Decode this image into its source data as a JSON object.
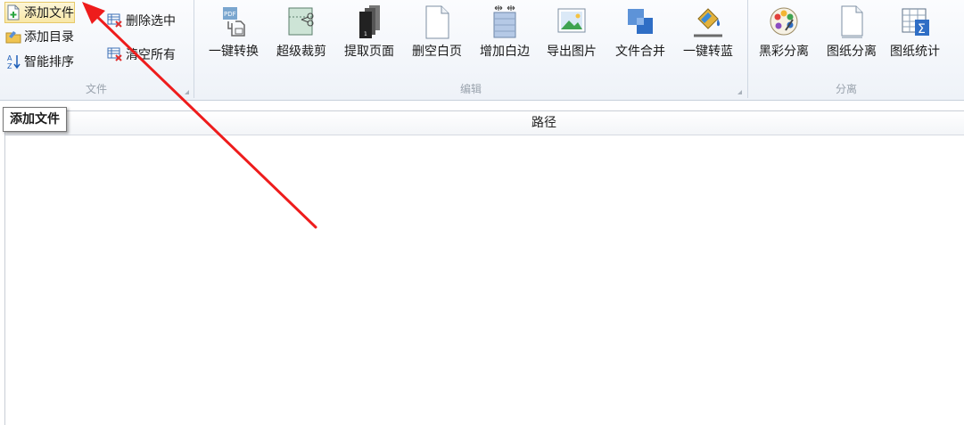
{
  "ribbon": {
    "file_group": {
      "label": "文件",
      "items": [
        {
          "label": "添加文件",
          "icon": "add-file-icon"
        },
        {
          "label": "添加目录",
          "icon": "add-folder-icon"
        },
        {
          "label": "智能排序",
          "icon": "sort-az-icon"
        },
        {
          "label": "删除选中",
          "icon": "delete-selected-icon"
        },
        {
          "label": "清空所有",
          "icon": "clear-all-icon"
        }
      ]
    },
    "edit_group": {
      "label": "编辑",
      "buttons": [
        {
          "label": "一键转换",
          "icon": "pdf-convert-icon"
        },
        {
          "label": "超级裁剪",
          "icon": "crop-scissors-icon"
        },
        {
          "label": "提取页面",
          "icon": "extract-pages-icon"
        },
        {
          "label": "删空白页",
          "icon": "blank-page-icon"
        },
        {
          "label": "增加白边",
          "icon": "add-margin-icon"
        },
        {
          "label": "导出图片",
          "icon": "export-image-icon"
        },
        {
          "label": "文件合并",
          "icon": "merge-files-icon"
        },
        {
          "label": "一键转蓝",
          "icon": "paint-bucket-icon"
        }
      ]
    },
    "separate_group": {
      "label": "分离",
      "buttons": [
        {
          "label": "黑彩分离",
          "icon": "color-palette-icon"
        },
        {
          "label": "图纸分离",
          "icon": "drawing-page-icon"
        },
        {
          "label": "图纸统计",
          "icon": "sum-table-icon"
        }
      ]
    }
  },
  "tooltip": {
    "text": "添加文件"
  },
  "file_list": {
    "columns": [
      {
        "label": "路径"
      }
    ]
  },
  "annotation": {
    "color": "#ee1c1c"
  }
}
